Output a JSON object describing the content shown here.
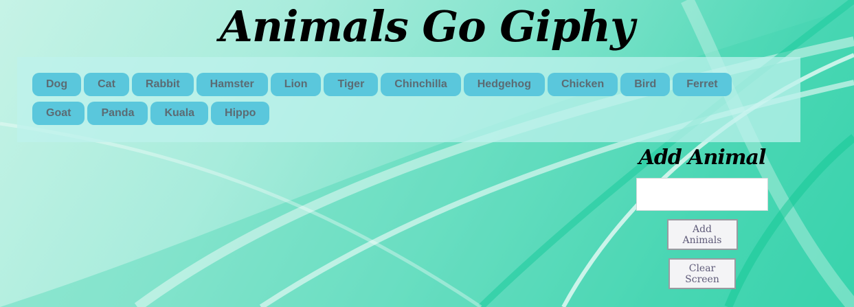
{
  "header": {
    "title": "Animals Go Giphy"
  },
  "animals": {
    "row1": [
      "Dog",
      "Cat",
      "Rabbit",
      "Hamster",
      "Lion",
      "Tiger",
      "Chinchilla",
      "Hedgehog",
      "Chicken",
      "Bird",
      "Ferret"
    ],
    "row2": [
      "Goat",
      "Panda",
      "Kuala",
      "Hippo"
    ]
  },
  "add_form": {
    "heading": "Add Animal",
    "input_value": "",
    "add_button": "Add Animals",
    "clear_button": "Clear Screen"
  },
  "colors": {
    "button_bg": "#5ac7dc",
    "button_text": "#5b6b73",
    "panel_bg": "#bef2ec",
    "background_accent": "#35d3ab"
  }
}
